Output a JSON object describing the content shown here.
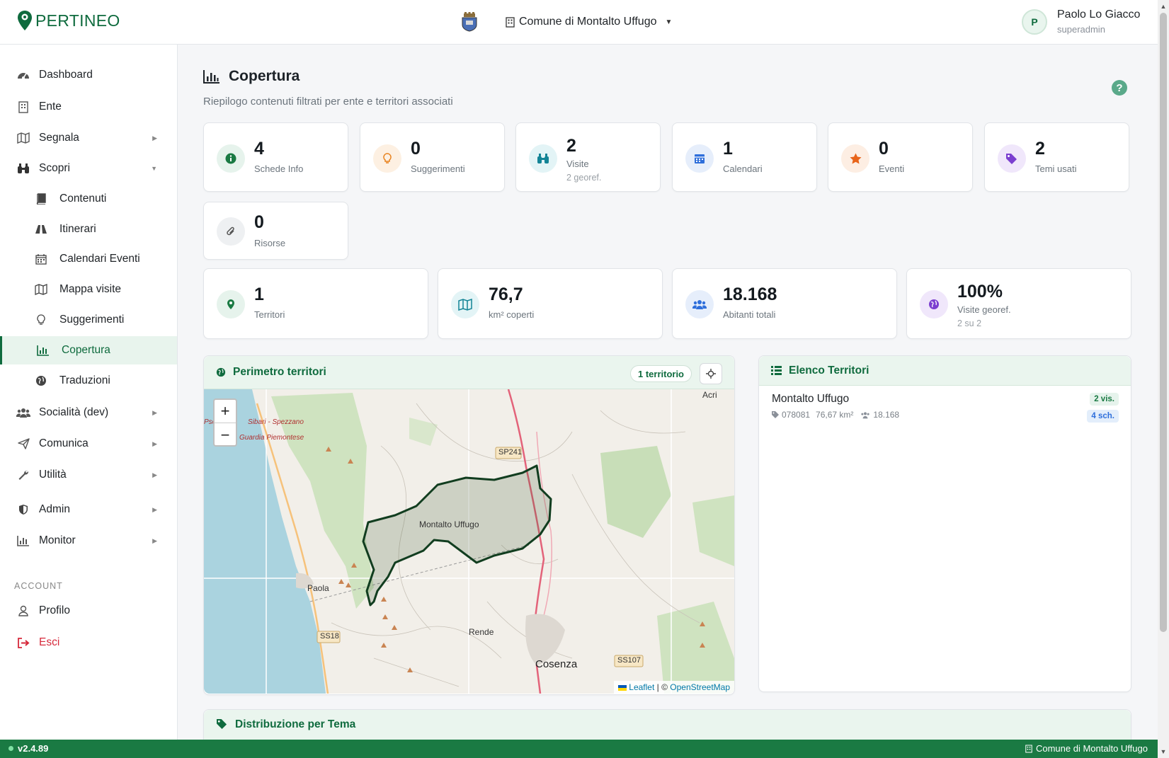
{
  "brand": {
    "name": "PERTINEO",
    "color": "#0f6b3e"
  },
  "header": {
    "ente_label": "Comune di Montalto Uffugo",
    "user_initial": "P",
    "user_name": "Paolo Lo Giacco",
    "user_role": "superadmin"
  },
  "sidebar": {
    "items": [
      {
        "label": "Dashboard"
      },
      {
        "label": "Ente"
      },
      {
        "label": "Segnala"
      },
      {
        "label": "Scopri"
      },
      {
        "label": "Contenuti"
      },
      {
        "label": "Itinerari"
      },
      {
        "label": "Calendari Eventi"
      },
      {
        "label": "Mappa visite"
      },
      {
        "label": "Suggerimenti"
      },
      {
        "label": "Copertura"
      },
      {
        "label": "Traduzioni"
      },
      {
        "label": "Socialità (dev)"
      },
      {
        "label": "Comunica"
      },
      {
        "label": "Utilità"
      },
      {
        "label": "Admin"
      },
      {
        "label": "Monitor"
      }
    ],
    "account_label": "ACCOUNT",
    "account_items": [
      {
        "label": "Profilo"
      },
      {
        "label": "Esci"
      }
    ]
  },
  "page": {
    "title": "Copertura",
    "subtitle": "Riepilogo contenuti filtrati per ente e territori associati"
  },
  "stats": [
    {
      "value": "4",
      "label": "Schede Info",
      "icon": "info-icon",
      "color": "#1a7a43"
    },
    {
      "value": "0",
      "label": "Suggerimenti",
      "icon": "lightbulb-icon",
      "color": "#e8801a"
    },
    {
      "value": "2",
      "label": "Visite",
      "extra": "2 georef.",
      "icon": "binoculars-icon",
      "color": "#138496"
    },
    {
      "value": "1",
      "label": "Calendari",
      "icon": "calendar-icon",
      "color": "#2f6fdb"
    },
    {
      "value": "0",
      "label": "Eventi",
      "icon": "star-icon",
      "color": "#e8641a"
    },
    {
      "value": "2",
      "label": "Temi usati",
      "icon": "tags-icon",
      "color": "#7b3fd0"
    },
    {
      "value": "0",
      "label": "Risorse",
      "icon": "paperclip-icon",
      "color": "#6c757d"
    }
  ],
  "territory_stats": [
    {
      "value": "1",
      "label": "Territori",
      "icon": "map-pin-icon",
      "color": "#1a7a43"
    },
    {
      "value": "76,7",
      "label": "km² coperti",
      "icon": "map-icon",
      "color": "#138496"
    },
    {
      "value": "18.168",
      "label": "Abitanti totali",
      "icon": "users-icon",
      "color": "#2f6fdb"
    },
    {
      "value": "100%",
      "label": "Visite georef.",
      "extra": "2 su 2",
      "icon": "globe-icon",
      "color": "#7b3fd0"
    }
  ],
  "map_panel": {
    "title": "Perimetro territori",
    "badge": "1 territorio",
    "zoom_in": "+",
    "zoom_out": "−",
    "attribution_leaflet": "Leaflet",
    "attribution_sep": "| ©",
    "attribution_osm": "OpenStreetMap",
    "places": {
      "montalto": "Montalto Uffugo",
      "paola": "Paola",
      "rende": "Rende",
      "cosenza": "Cosenza",
      "acri": "Acri",
      "sibari": "Sibari - Spezzano",
      "guardia": "Guardia Piemontese",
      "pse": "Pse",
      "sp241": "SP241",
      "ss18": "SS18",
      "ss107": "SS107"
    }
  },
  "list_panel": {
    "title": "Elenco Territori",
    "territories": [
      {
        "name": "Montalto Uffugo",
        "code": "078081",
        "area": "76,67 km²",
        "population": "18.168",
        "visits_badge": "2 vis.",
        "cards_badge": "4 sch."
      }
    ]
  },
  "tema_panel": {
    "title": "Distribuzione per Tema"
  },
  "footer": {
    "version": "v2.4.89",
    "ente": "Comune di Montalto Uffugo"
  }
}
